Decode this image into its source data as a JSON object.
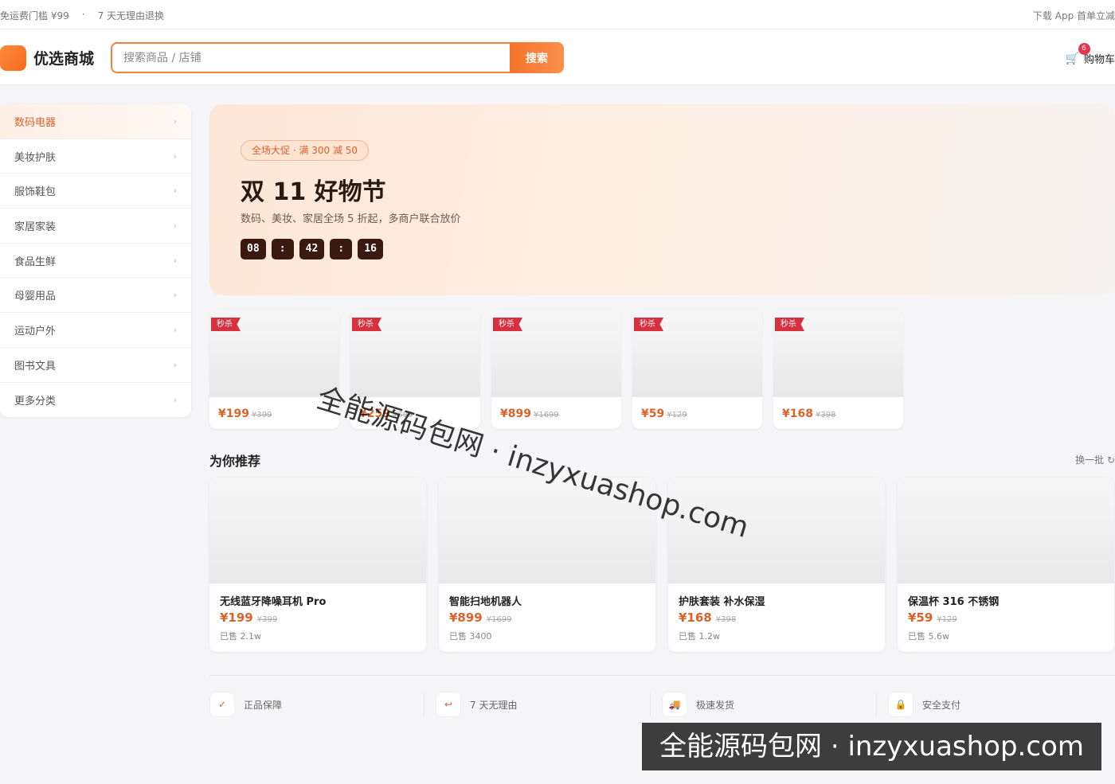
{
  "topbar": {
    "left_items": [
      "免运费门槛 ¥99",
      "·",
      "7 天无理由退换"
    ],
    "right_text": "下载 App 首单立减"
  },
  "header": {
    "logo_text": "优选商城",
    "search_placeholder": "搜索商品 / 店铺",
    "search_button": "搜索",
    "cart_label": "购物车",
    "cart_badge": "6",
    "cart_icon": "cart-icon"
  },
  "sidebar": {
    "items": [
      {
        "label": "数码电器",
        "active": true
      },
      {
        "label": "美妆护肤"
      },
      {
        "label": "服饰鞋包"
      },
      {
        "label": "家居家装"
      },
      {
        "label": "食品生鲜"
      },
      {
        "label": "母婴用品"
      },
      {
        "label": "运动户外"
      },
      {
        "label": "图书文具"
      },
      {
        "label": "更多分类"
      }
    ],
    "chevron": "›"
  },
  "banner": {
    "tag": "全场大促 · 满 300 减 50",
    "title": "双 11 好物节",
    "subtitle": "数码、美妆、家居全场 5 折起，多商户联合放价",
    "countdown": [
      "08",
      ":",
      "42",
      ":",
      "16"
    ]
  },
  "flash_sale": {
    "tag": "秒杀",
    "items": [
      {
        "price": "¥199",
        "original": "¥399"
      },
      {
        "price": "¥259",
        "original": "¥599"
      },
      {
        "price": "¥899",
        "original": "¥1699"
      },
      {
        "price": "¥59",
        "original": "¥129"
      },
      {
        "price": "¥168",
        "original": "¥398"
      }
    ]
  },
  "recommend": {
    "title": "为你推荐",
    "refresh": "换一批 ↻",
    "items": [
      {
        "name": "无线蓝牙降噪耳机 Pro",
        "price": "¥199",
        "original": "¥399",
        "sold": "已售 2.1w"
      },
      {
        "name": "智能扫地机器人",
        "price": "¥899",
        "original": "¥1699",
        "sold": "已售 3400"
      },
      {
        "name": "护肤套装 补水保湿",
        "price": "¥168",
        "original": "¥398",
        "sold": "已售 1.2w"
      },
      {
        "name": "保温杯 316 不锈钢",
        "price": "¥59",
        "original": "¥129",
        "sold": "已售 5.6w"
      }
    ]
  },
  "guarantees": [
    {
      "icon": "check-icon",
      "glyph": "✓",
      "label": "正品保障"
    },
    {
      "icon": "return-icon",
      "glyph": "↩",
      "label": "7 天无理由"
    },
    {
      "icon": "truck-icon",
      "glyph": "🚚",
      "label": "极速发货"
    },
    {
      "icon": "lock-icon",
      "glyph": "🔒",
      "label": "安全支付"
    }
  ],
  "watermark": {
    "diagonal": "全能源码包网 · inzyxuashop.com",
    "box": "全能源码包网 · inzyxuashop.com"
  },
  "colors": {
    "accent": "#f1833e",
    "price": "#d9622a",
    "flash_tag": "#d8303f",
    "countdown_bg": "#3a1a0f"
  }
}
